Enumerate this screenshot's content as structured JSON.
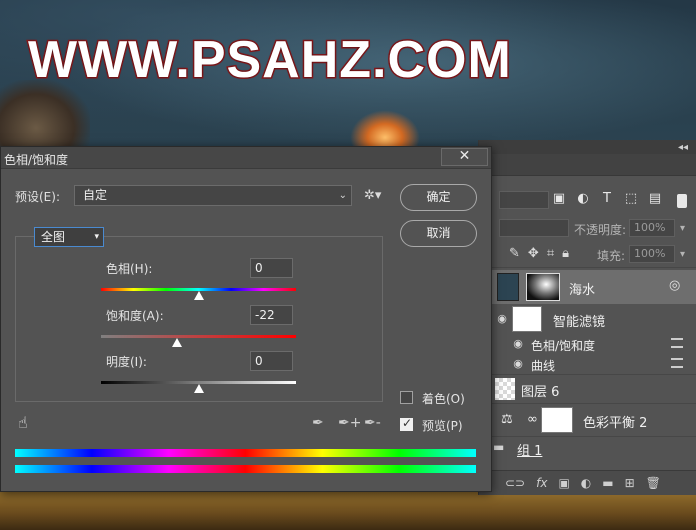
{
  "watermark": "WWW.PSAHZ.COM",
  "dialog": {
    "title": "色相/饱和度",
    "close_label": "✕",
    "preset_label": "预设(E):",
    "preset_value": "自定",
    "ok_label": "确定",
    "cancel_label": "取消",
    "channel_value": "全图",
    "hue": {
      "label": "色相(H):",
      "value": "0",
      "position": 0.5
    },
    "saturation": {
      "label": "饱和度(A):",
      "value": "-22",
      "position": 0.39
    },
    "lightness": {
      "label": "明度(I):",
      "value": "0",
      "position": 0.5
    },
    "colorize": {
      "label": "着色(O)",
      "checked": false
    },
    "preview": {
      "label": "预览(P)",
      "checked": true
    }
  },
  "layers_panel": {
    "opacity_label": "不透明度:",
    "opacity_value": "100%",
    "fill_label": "填充:",
    "fill_value": "100%",
    "layers": [
      {
        "name": "海水",
        "type": "smart-object"
      },
      {
        "name": "智能滤镜",
        "type": "smart-filters"
      },
      {
        "name": "色相/饱和度",
        "type": "filter"
      },
      {
        "name": "曲线",
        "type": "filter"
      },
      {
        "name": "图层 6",
        "type": "pixel"
      },
      {
        "name": "色彩平衡 2",
        "type": "adjustment"
      },
      {
        "name": "组 1",
        "type": "group"
      }
    ]
  },
  "colors": {
    "dialog_bg": "#535353",
    "watermark_stroke": "#8c1b1e",
    "focus_border": "#4a8ad0"
  }
}
